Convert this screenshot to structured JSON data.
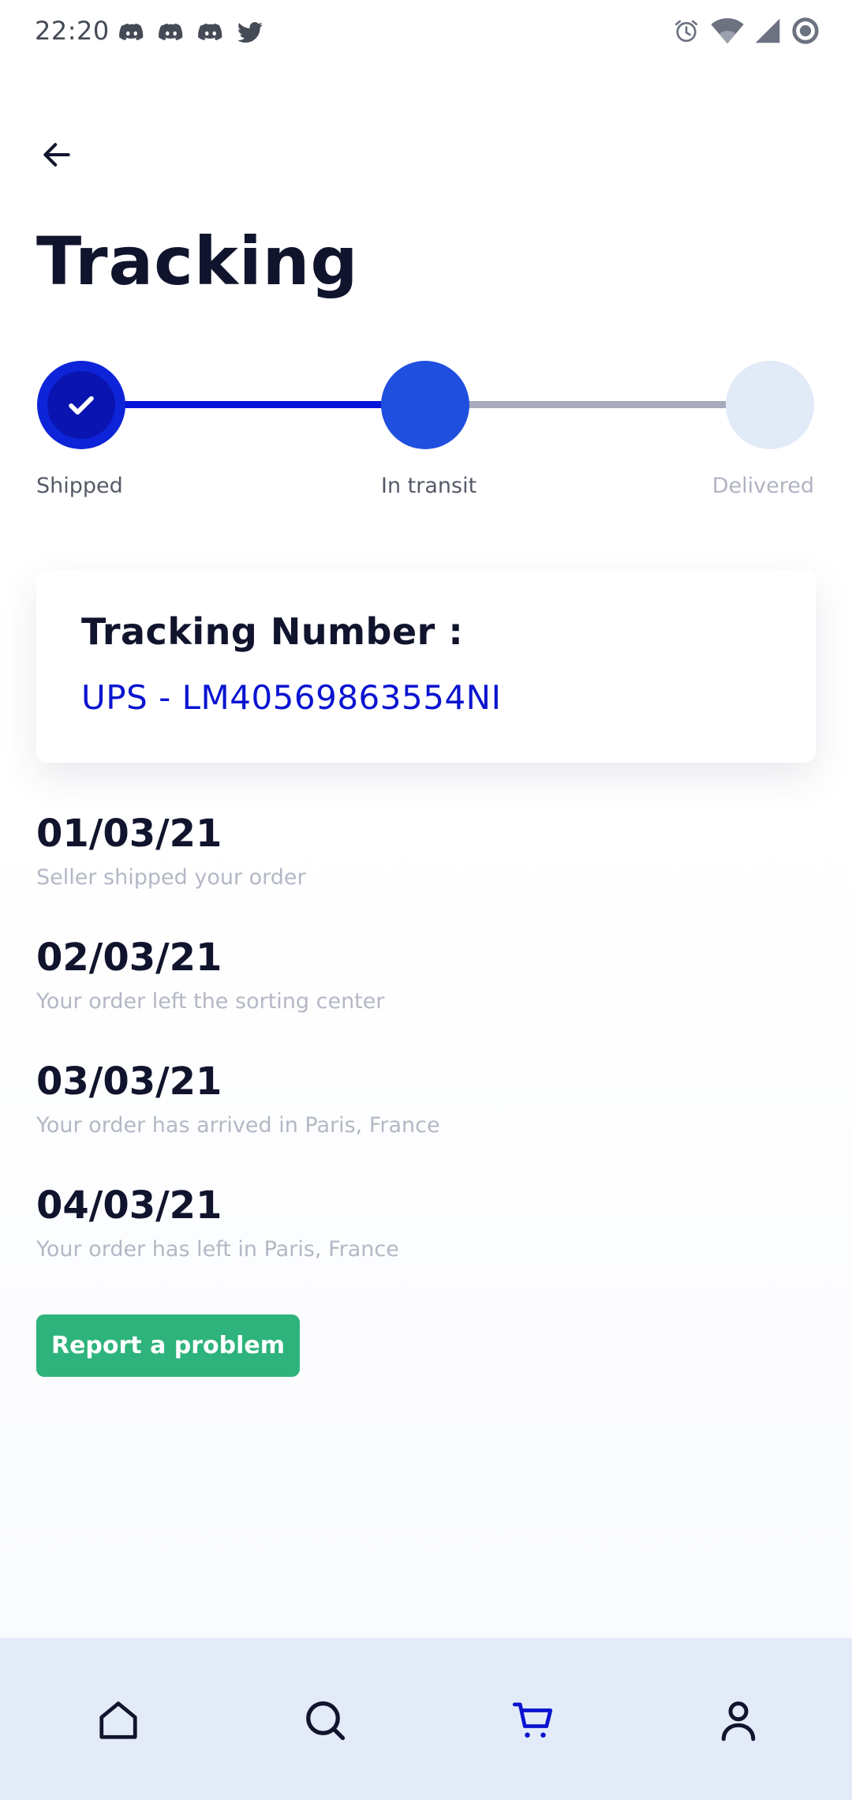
{
  "status_bar": {
    "time": "22:20",
    "notification_icons": [
      "discord-icon",
      "discord-icon",
      "discord-icon",
      "twitter-icon"
    ],
    "system_icons": [
      "alarm-icon",
      "wifi-icon",
      "cellular-signal-icon",
      "sync-icon"
    ]
  },
  "header": {
    "back_icon": "arrow-left-icon",
    "title": "Tracking"
  },
  "stepper": {
    "steps": [
      {
        "label": "Shipped",
        "state": "completed"
      },
      {
        "label": "In transit",
        "state": "current"
      },
      {
        "label": "Delivered",
        "state": "pending"
      }
    ],
    "colors": {
      "completed": "#0d24d8",
      "current": "#1f4fdf",
      "pending": "#e1eaf7",
      "line_done": "#0414d8",
      "line_pending": "#a7a9bd"
    }
  },
  "tracking_card": {
    "title": "Tracking Number :",
    "number": "UPS - LM40569863554NI"
  },
  "timeline": [
    {
      "date": "01/03/21",
      "description": "Seller shipped your order"
    },
    {
      "date": "02/03/21",
      "description": "Your order left the sorting center"
    },
    {
      "date": "03/03/21",
      "description": "Your order has arrived in Paris, France"
    },
    {
      "date": "04/03/21",
      "description": "Your order has left in Paris, France"
    }
  ],
  "report_button": {
    "label": "Report a problem",
    "color": "#2db37b"
  },
  "bottom_nav": {
    "items": [
      {
        "icon": "home-icon",
        "active": false
      },
      {
        "icon": "search-icon",
        "active": false
      },
      {
        "icon": "cart-icon",
        "active": true
      },
      {
        "icon": "profile-icon",
        "active": false
      }
    ],
    "active_color": "#0a14d0",
    "inactive_color": "#11142d"
  }
}
